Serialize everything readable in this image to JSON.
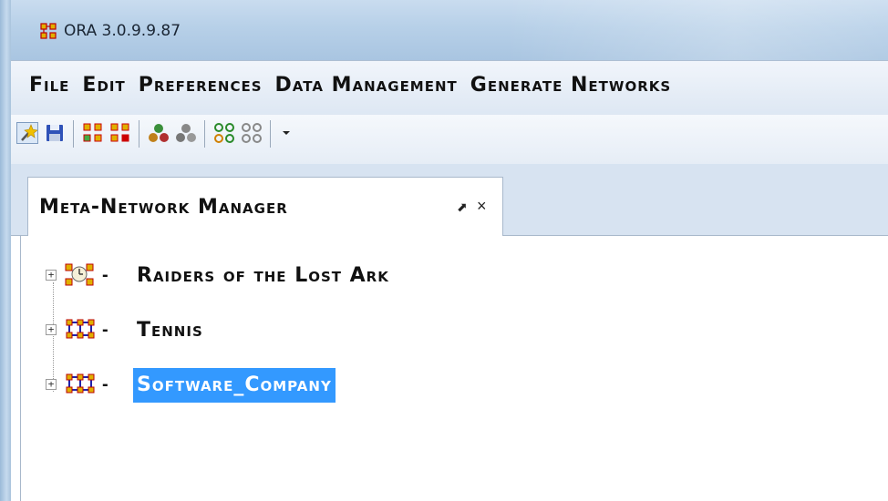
{
  "window": {
    "title": "ORA 3.0.9.9.87"
  },
  "menu": {
    "items": [
      "File",
      "Edit",
      "Preferences",
      "Data Management",
      "Generate Networks"
    ]
  },
  "toolbar": {
    "icons": [
      "wizard-icon",
      "save-icon",
      "network-add-icon",
      "network-remove-icon",
      "agents-icon",
      "agents-disabled-icon",
      "nodes-icon",
      "nodes-disabled-icon",
      "dropdown-icon"
    ]
  },
  "tab": {
    "label": "Meta-Network Manager",
    "close": "×",
    "pin": "⬈"
  },
  "tree": {
    "items": [
      {
        "label": "Raiders of the Lost Ark",
        "expander": "+",
        "selected": false
      },
      {
        "label": "Tennis",
        "expander": "+",
        "selected": false
      },
      {
        "label": "Software_Company",
        "expander": "+",
        "selected": true
      }
    ]
  },
  "colors": {
    "selection": "#3399ff",
    "title_bar": "#b7d0e8"
  }
}
